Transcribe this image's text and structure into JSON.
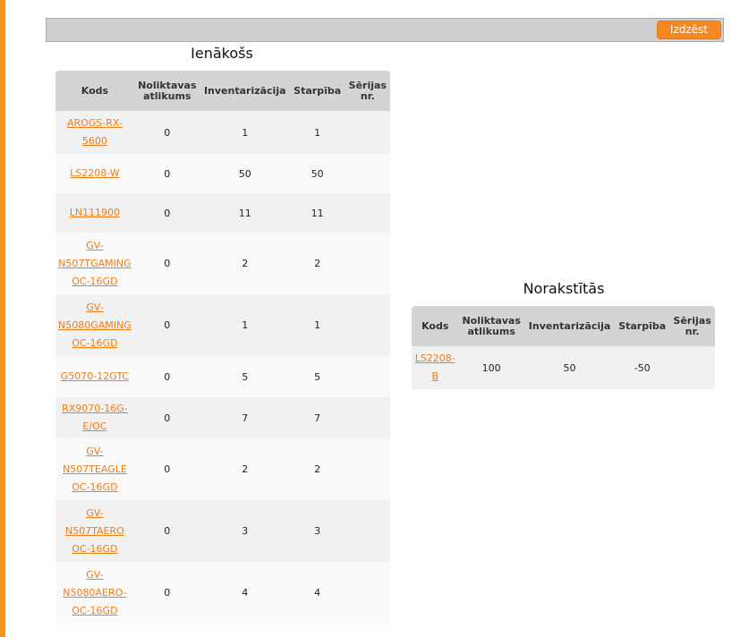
{
  "toolbar": {
    "delete_label": "Izdzēst"
  },
  "incoming": {
    "title": "Ienākošs",
    "headers": [
      "Kods",
      "Noliktavas atlikums",
      "Inventarizācija",
      "Starpība",
      "Sērijas nr."
    ],
    "rows": [
      {
        "code": "AROGS-RX-5600",
        "stock": "0",
        "inventory": "1",
        "diff": "1",
        "serial": ""
      },
      {
        "code": "LS2208-W",
        "stock": "0",
        "inventory": "50",
        "diff": "50",
        "serial": ""
      },
      {
        "code": "LN111900",
        "stock": "0",
        "inventory": "11",
        "diff": "11",
        "serial": ""
      },
      {
        "code": "GV-N507TGAMING OC-16GD",
        "stock": "0",
        "inventory": "2",
        "diff": "2",
        "serial": ""
      },
      {
        "code": "GV-N5080GAMING OC-16GD",
        "stock": "0",
        "inventory": "1",
        "diff": "1",
        "serial": ""
      },
      {
        "code": "G5070-12GTC",
        "stock": "0",
        "inventory": "5",
        "diff": "5",
        "serial": ""
      },
      {
        "code": "RX9070-16G-E/OC",
        "stock": "0",
        "inventory": "7",
        "diff": "7",
        "serial": ""
      },
      {
        "code": "GV-N507TEAGLE OC-16GD",
        "stock": "0",
        "inventory": "2",
        "diff": "2",
        "serial": ""
      },
      {
        "code": "GV-N507TAERO OC-16GD",
        "stock": "0",
        "inventory": "3",
        "diff": "3",
        "serial": ""
      },
      {
        "code": "GV-N5080AERO-OC-16GD",
        "stock": "0",
        "inventory": "4",
        "diff": "4",
        "serial": ""
      }
    ]
  },
  "writtenoff": {
    "title": "Norakstītās",
    "headers": [
      "Kods",
      "Noliktavas atlikums",
      "Inventarizācija",
      "Starpība",
      "Sērijas nr."
    ],
    "rows": [
      {
        "code": "LS2208-B",
        "stock": "100",
        "inventory": "50",
        "diff": "-50",
        "serial": ""
      }
    ]
  },
  "colors": {
    "accent": "#f7941d",
    "link": "#f07d16",
    "header_bg": "#d4d4d4"
  }
}
